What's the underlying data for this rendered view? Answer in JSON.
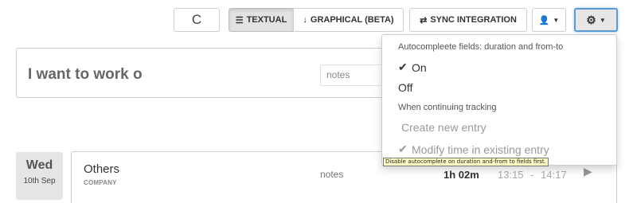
{
  "toolbar": {
    "refresh_icon": "refresh-icon",
    "refresh_glyph": "C",
    "textual_label": "TEXTUAL",
    "textual_icon_glyph": "☰",
    "graphical_label": "GRAPHICAL (BETA)",
    "graphical_icon_glyph": "↓",
    "sync_label": "SYNC INTEGRATION",
    "sync_icon_glyph": "⇄",
    "user_icon_glyph": "👤",
    "settings_icon_glyph": "⚙",
    "caret_glyph": "▼"
  },
  "entry": {
    "description": "I want to work o",
    "notes_placeholder": "notes"
  },
  "dropdown": {
    "header_autocomplete": "Autocompleete fields: duration and from-to",
    "on_label": "On",
    "off_label": "Off",
    "header_continuing": "When continuing tracking",
    "create_label": "Create new entry",
    "modify_label": "Modify time in existing entry",
    "check_glyph": "✔"
  },
  "tooltip": {
    "text": "Disable autocomplete on duration and-from to fields first."
  },
  "day": {
    "name": "Wed",
    "date": "10th Sep"
  },
  "entries": [
    {
      "project": "Others",
      "company": "COMPANY",
      "notes": "notes",
      "duration": "1h 02m",
      "start": "13:15",
      "separator": "-",
      "end": "14:17",
      "play_glyph": "▶"
    }
  ],
  "colors": {
    "settings_focus": "#5b9bd5",
    "tooltip_bg": "#fffcc4"
  }
}
